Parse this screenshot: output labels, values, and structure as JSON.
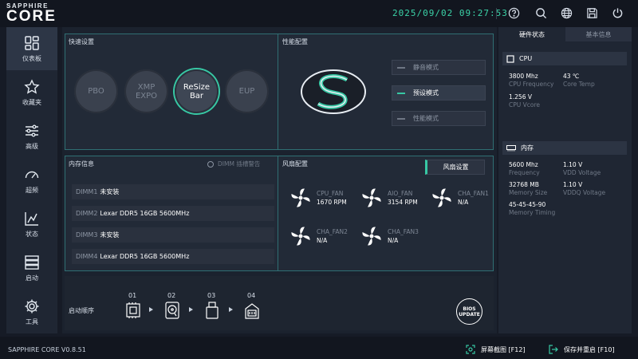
{
  "brand": {
    "line1": "SAPPHIRE",
    "line2": "CORE"
  },
  "clock": "2025/09/02 09:27:53",
  "top_icons": [
    "help-icon",
    "search-icon",
    "globe-icon",
    "save-icon",
    "power-icon"
  ],
  "sidebar": {
    "items": [
      {
        "label": "仪表板",
        "icon": "dashboard-icon",
        "active": true
      },
      {
        "label": "收藏夹",
        "icon": "star-icon",
        "active": false
      },
      {
        "label": "高级",
        "icon": "sliders-icon",
        "active": false
      },
      {
        "label": "超频",
        "icon": "gauge-icon",
        "active": false
      },
      {
        "label": "状态",
        "icon": "chart-icon",
        "active": false
      },
      {
        "label": "启动",
        "icon": "server-icon",
        "active": false
      },
      {
        "label": "工具",
        "icon": "gear-icon",
        "active": false
      }
    ]
  },
  "quick_settings": {
    "title": "快速设置",
    "buttons": [
      {
        "label": "PBO",
        "on": false
      },
      {
        "label": "XMP\nEXPO",
        "on": false
      },
      {
        "label": "ReSize\nBar",
        "on": true
      },
      {
        "label": "EUP",
        "on": false
      }
    ]
  },
  "performance": {
    "title": "性能配置",
    "modes": [
      {
        "label": "静音模式",
        "on": false
      },
      {
        "label": "预设模式",
        "on": true
      },
      {
        "label": "性能模式",
        "on": false
      }
    ]
  },
  "memory": {
    "title": "内存信息",
    "warning_label": "DIMM 插槽警告",
    "slots": [
      {
        "slot": "DIMM1",
        "value": "未安装"
      },
      {
        "slot": "DIMM2",
        "value": "Lexar DDR5 16GB 5600MHz"
      },
      {
        "slot": "DIMM3",
        "value": "未安装"
      },
      {
        "slot": "DIMM4",
        "value": "Lexar DDR5 16GB 5600MHz"
      }
    ]
  },
  "fans": {
    "title": "风扇配置",
    "button": "风扇设置",
    "items": [
      {
        "name": "CPU_FAN",
        "value": "1670 RPM"
      },
      {
        "name": "AIO_FAN",
        "value": "3154 RPM"
      },
      {
        "name": "CHA_FAN1",
        "value": "N/A"
      },
      {
        "name": "CHA_FAN2",
        "value": "N/A"
      },
      {
        "name": "CHA_FAN3",
        "value": "N/A"
      }
    ]
  },
  "boot": {
    "title": "启动顺序",
    "items": [
      {
        "num": "01",
        "icon": "chip-icon"
      },
      {
        "num": "02",
        "icon": "disk-icon"
      },
      {
        "num": "03",
        "icon": "usb-icon"
      },
      {
        "num": "04",
        "icon": "network-icon"
      }
    ],
    "bios_update": "BIOS\nUPDATE"
  },
  "right_panel": {
    "tabs": [
      {
        "label": "硬件状态",
        "active": true
      },
      {
        "label": "基本信息",
        "active": false
      }
    ],
    "cpu": {
      "title": "CPU",
      "freq_value": "3800 Mhz",
      "freq_label": "CPU Frequency",
      "temp_value": "43 ℃",
      "temp_label": "Core Temp",
      "vcore_value": "1.256 V",
      "vcore_label": "CPU Vcore"
    },
    "memory": {
      "title": "内存",
      "freq_value": "5600 Mhz",
      "freq_label": "Frequency",
      "vdd_value": "1.10 V",
      "vdd_label": "VDD Voltage",
      "size_value": "32768 MB",
      "size_label": "Memory Size",
      "vddq_value": "1.10 V",
      "vddq_label": "VDDQ Voltage",
      "timing_value": "45-45-45-90",
      "timing_label": "Memory Timing"
    }
  },
  "bottom": {
    "version": "SAPPHIRE CORE V0.8.51",
    "screenshot": "屏幕截图 [F12]",
    "save_exit": "保存并重启 [F10]"
  },
  "colors": {
    "accent": "#37c8a4",
    "clock": "#3bd3a8",
    "panel_border": "#2f6f73"
  }
}
